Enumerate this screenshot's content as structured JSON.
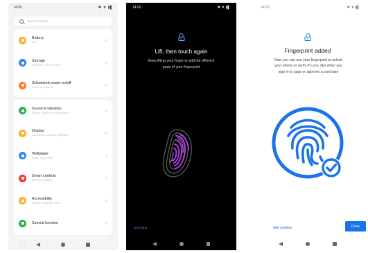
{
  "screens": {
    "settings": {
      "time": "14:00",
      "status_icons": "✱ ▼ ▮▌",
      "search_placeholder": "Search settings",
      "items": [
        {
          "label": "Battery",
          "sub": "55%",
          "icon": "battery-icon",
          "color": "#f5b335"
        },
        {
          "label": "Storage",
          "sub": "25% used - 48.00 GB free",
          "icon": "storage-icon",
          "color": "#2f87f2"
        },
        {
          "label": "Scheduled power on/off",
          "sub": "Power on power off",
          "icon": "clock-icon",
          "color": "#ff7a1c"
        },
        {
          "label": "Sound & vibration",
          "sub": "Volume, vibration, Do Not Disturb",
          "icon": "speaker-icon",
          "color": "#26b24f"
        },
        {
          "label": "Display",
          "sub": "Dark theme, font size, brightness",
          "icon": "display-icon",
          "color": "#f5b335"
        },
        {
          "label": "Wallpaper",
          "sub": "Styles, Iock screen",
          "icon": "wallpaper-icon",
          "color": "#2f87f2"
        },
        {
          "label": "Smart controls",
          "sub": "All-in-one controls",
          "icon": "hand-icon",
          "color": "#ee3b31"
        },
        {
          "label": "Accessibility",
          "sub": "Display, interaction, audio",
          "icon": "accessibility-icon",
          "color": "#f5b335"
        },
        {
          "label": "Special function",
          "sub": "",
          "icon": "star-icon",
          "color": "#26b24f"
        }
      ]
    },
    "enroll": {
      "time": "14:00",
      "status_icons": "✱ ▼ ▮▌",
      "title": "Lift, then touch again",
      "desc_line1": "Keep lifting your finger to add the different",
      "desc_line2": "parts of your fingerprint",
      "later_label": "Do it later"
    },
    "added": {
      "time": "14:00",
      "status_icons": "✱ ▼ ▮▌",
      "title": "Fingerprint added",
      "desc_line1": "Now you can use your fingerprint to unlock",
      "desc_line2": "your phone or verify it's you, like when you",
      "desc_line3": "sign in to apps or approve a purchase",
      "add_another_label": "Add another",
      "done_label": "Done"
    }
  },
  "colors": {
    "accent_blue": "#1a73e8",
    "enroll_link": "#4f8ff7",
    "fingerprint_purple": "#a23bd1"
  }
}
